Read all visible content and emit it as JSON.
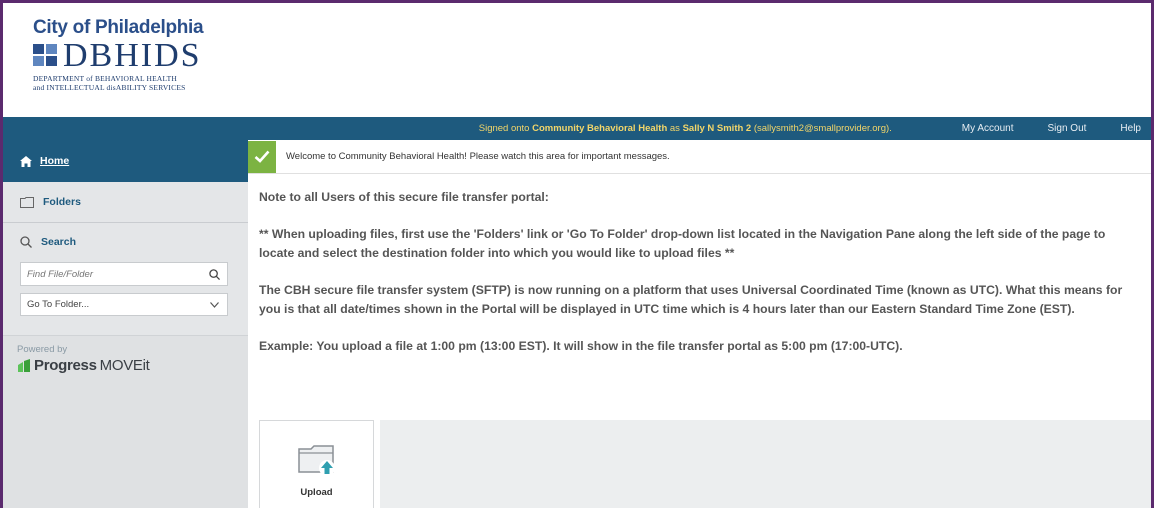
{
  "logo": {
    "city": "City of Philadelphia",
    "name": "DBHIDS",
    "sub1": "DEPARTMENT of BEHAVIORAL HEALTH",
    "sub2": "and INTELLECTUAL disABILITY SERVICES"
  },
  "topbar": {
    "signed_prefix": "Signed onto",
    "org": "Community Behavioral Health",
    "as": "as",
    "user": "Sally N Smith 2",
    "email": "(sallysmith2@smallprovider.org).",
    "links": [
      "My Account",
      "Sign Out",
      "Help"
    ]
  },
  "sidebar": {
    "home": "Home",
    "folders": "Folders",
    "search": "Search",
    "search_placeholder": "Find File/Folder",
    "goto": "Go To Folder...",
    "powered_by": "Powered by",
    "brand": "Progress",
    "product": "MOVEit"
  },
  "main": {
    "message": "Welcome to Community Behavioral Health! Please watch this area for important messages.",
    "notes": [
      "Note to all Users of this secure file transfer portal:",
      "** When uploading files, first use the 'Folders' link or 'Go To Folder' drop-down list located in the Navigation Pane along the left side of the page to locate and select the destination folder into which you would like to upload files **",
      "The CBH secure file transfer system (SFTP) is now running on a platform that uses Universal Coordinated Time (known as UTC). What this means for you is that all date/times shown in the Portal will be displayed in UTC time which is 4 hours later than our Eastern Standard Time Zone (EST).",
      "Example: You upload a file at 1:00 pm (13:00 EST). It will show in the file transfer portal as 5:00 pm (17:00-UTC)."
    ],
    "upload": "Upload"
  },
  "colors": {
    "nav": "#1e5a7e",
    "accent_green": "#7cb342",
    "frame": "#5b2a6e",
    "signed_text": "#f2d66a"
  },
  "icons": [
    "home-icon",
    "folder-icon",
    "search-icon",
    "chevron-down-icon",
    "check-icon",
    "upload-folder-icon",
    "progress-logo-icon"
  ]
}
